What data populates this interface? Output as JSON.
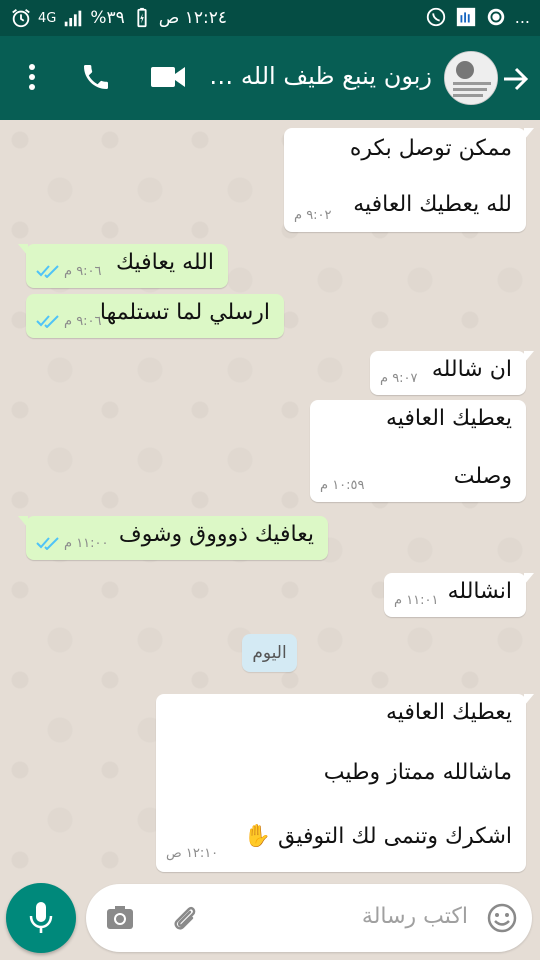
{
  "status_bar": {
    "time": "١٢:٢٤ ص",
    "battery": "٣٩%",
    "network": "4G",
    "dots": "..."
  },
  "header": {
    "contact_name": "زبون ينبع ظيف الله ا...",
    "back_icon": "arrow-back-icon",
    "video_icon": "video-call-icon",
    "call_icon": "phone-icon",
    "menu_icon": "more-vert-icon"
  },
  "messages": [
    {
      "dir": "in",
      "lines": [
        "ممكن توصل بكره",
        "لله يعطيك العافيه"
      ],
      "time": "٩:٠٢ م"
    },
    {
      "dir": "out",
      "lines": [
        "الله يعافيك"
      ],
      "time": "٩:٠٦ م",
      "status": "read"
    },
    {
      "dir": "out",
      "lines": [
        "ارسلي لما تستلمها"
      ],
      "time": "٩:٠٦ م",
      "status": "read"
    },
    {
      "dir": "in",
      "lines": [
        "ان شالله"
      ],
      "time": "٩:٠٧ م"
    },
    {
      "dir": "in",
      "lines": [
        "يعطيك العافيه",
        "وصلت"
      ],
      "time": "١٠:٥٩ م"
    },
    {
      "dir": "out",
      "lines": [
        "يعافيك ذوووق وشوف"
      ],
      "time": "١١:٠٠ م",
      "status": "read"
    },
    {
      "dir": "in",
      "lines": [
        "انشالله"
      ],
      "time": "١١:٠١ م"
    },
    {
      "dir": "in",
      "lines": [
        "يعطيك العافيه",
        "ماشالله ممتاز وطيب",
        "اشكرك  وتنمى لك التوفيق ✋"
      ],
      "time": "١٢:١٠ ص"
    }
  ],
  "date_chip": "اليوم",
  "composer": {
    "placeholder": "اكتب رسالة",
    "emoji_icon": "emoji-icon",
    "attach_icon": "paperclip-icon",
    "camera_icon": "camera-icon",
    "mic_icon": "mic-icon"
  },
  "colors": {
    "header": "#075e54",
    "status_bar": "#054d44",
    "outgoing_bubble": "#dcf8c6",
    "incoming_bubble": "#ffffff",
    "read_ticks": "#4fc3f7",
    "mic_button": "#00897b"
  }
}
